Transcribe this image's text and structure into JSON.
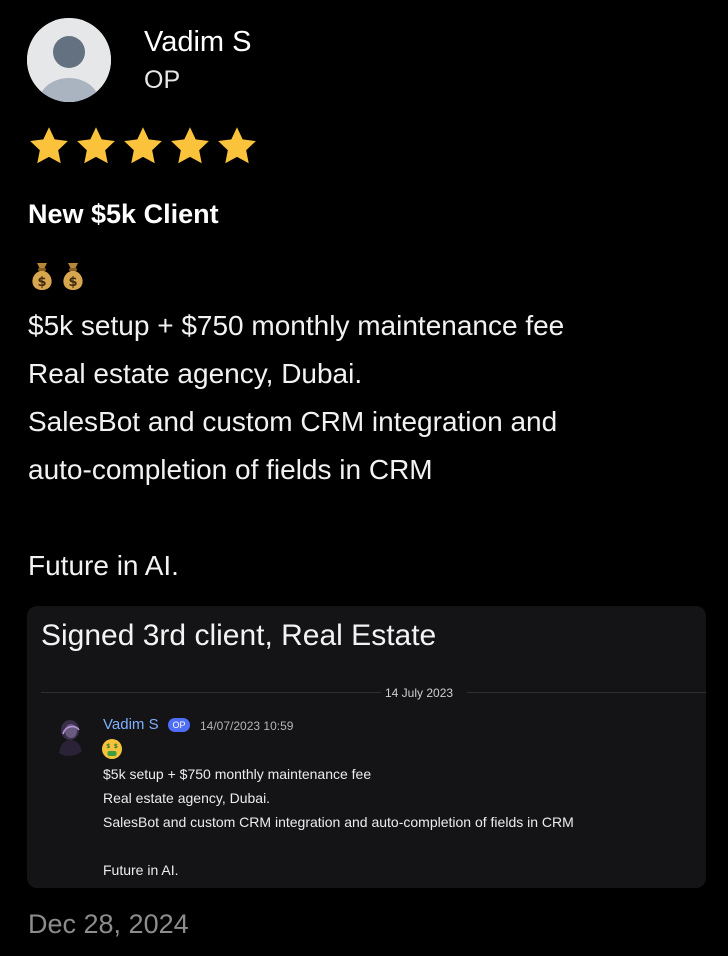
{
  "review": {
    "author": {
      "name": "Vadim S",
      "role": "OP",
      "avatar_icon": "user-avatar-icon"
    },
    "rating": {
      "stars": 5,
      "max": 5,
      "star_color": "#fbc33b"
    },
    "title": "New $5k Client",
    "emoji": [
      "money-bag-icon",
      "money-bag-icon"
    ],
    "body_lines": [
      "$5k setup + $750 monthly maintenance fee",
      "Real estate agency, Dubai.",
      "SalesBot and custom CRM integration and",
      "auto-completion of fields in CRM",
      "",
      "Future in AI."
    ],
    "date": "Dec 28, 2024"
  },
  "screenshot": {
    "title": "Signed 3rd client, Real Estate",
    "date_divider": "14 July 2023",
    "message": {
      "author": "Vadim S",
      "badge": "OP",
      "timestamp": "14/07/2023 10:59",
      "emoji": "money-mouth-face-icon",
      "lines": [
        "$5k setup + $750 monthly maintenance fee",
        "Real estate agency, Dubai.",
        "SalesBot and custom CRM integration and auto-completion of fields in CRM",
        "",
        "Future in AI."
      ]
    }
  },
  "colors": {
    "background": "#000000",
    "star": "#fbc33b",
    "card_background": "#141416",
    "username_blue": "#7fb0ff",
    "badge_blue": "#4f6ef7",
    "date_gray": "#8c8c8c"
  }
}
